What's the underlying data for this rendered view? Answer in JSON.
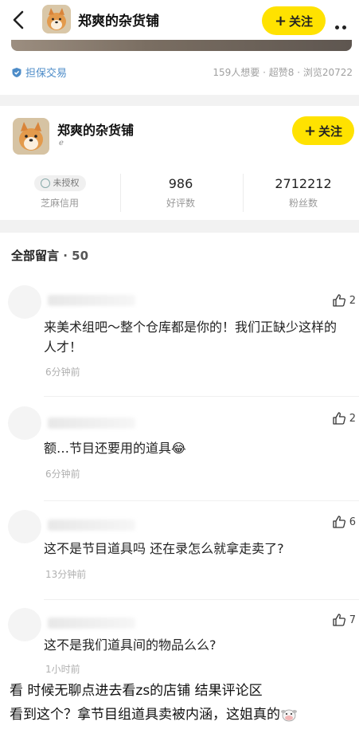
{
  "header": {
    "shop_name": "郑爽的杂货铺",
    "follow_label": "关注",
    "plus": "+"
  },
  "listing": {
    "guarantee_label": "担保交易",
    "stats": "159人想要 · 超赞8 · 浏览20722"
  },
  "shop": {
    "name": "郑爽的杂货铺",
    "sub": "ℯ",
    "follow_label": "关注",
    "plus": "+",
    "credit_badge": "未授权",
    "credit_label": "芝麻信用",
    "rating_value": "986",
    "rating_label": "好评数",
    "fans_value": "2712212",
    "fans_label": "粉丝数"
  },
  "comments": {
    "title": "全部留言",
    "count": " · 50",
    "items": [
      {
        "likes": "2",
        "text": "来美术组吧～整个仓库都是你的！我们正缺少这样的    人才！",
        "time": "6分钟前"
      },
      {
        "likes": "2",
        "text": "额…节目还要用的道具😂",
        "time": "6分钟前"
      },
      {
        "likes": "6",
        "text": "这不是节目道具吗 还在录怎么就拿走卖了?",
        "time": "13分钟前"
      },
      {
        "likes": "7",
        "text": "这不是我们道具间的物品么么?",
        "time": "1小时前"
      }
    ]
  },
  "caption": {
    "line1": "看        时候无聊点进去看zs的店铺 结果评论区",
    "line2": "看到这个？拿节目组道具卖被内涵，这姐真的"
  },
  "colors": {
    "accent_yellow": "#ffe200",
    "guarantee_blue": "#4d8cc8",
    "muted_gray": "#a0a0a0"
  }
}
